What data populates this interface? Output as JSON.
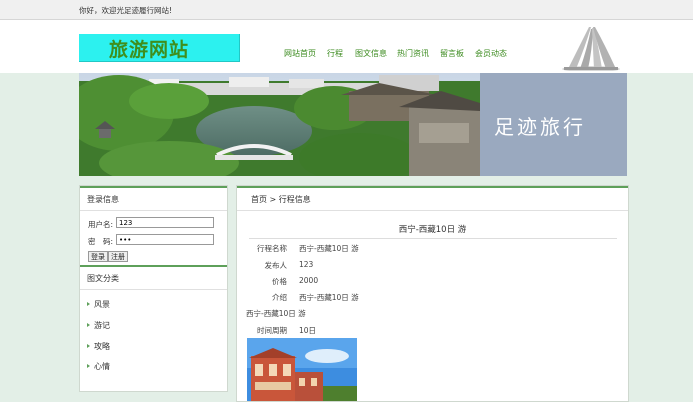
{
  "topbar": {
    "welcome": "你好，欢迎光足迹履行网站!"
  },
  "header": {
    "logo_text": "旅游网站",
    "nav": [
      "网站首页",
      "行程",
      "图文信息",
      "热门资讯",
      "留言板",
      "会员动态"
    ]
  },
  "banner": {
    "slogan": "足迹旅行"
  },
  "login": {
    "title": "登录信息",
    "username_label": "用户名:",
    "username_value": "123",
    "password_label": "密　码:",
    "password_value": "•••",
    "login_button": "登录",
    "register_button": "注册"
  },
  "categories": {
    "title": "图文分类",
    "items": [
      "风景",
      "游记",
      "攻略",
      "心情"
    ]
  },
  "breadcrumb": "首页 > 行程信息",
  "article": {
    "title": "西宁-西藏10日 游",
    "fields": [
      {
        "label": "行程名称",
        "value": "西宁-西藏10日 游"
      },
      {
        "label": "发布人",
        "value": "123"
      },
      {
        "label": "价格",
        "value": "2000"
      },
      {
        "label": "介绍",
        "value": "西宁-西藏10日 游"
      }
    ],
    "intro_text": "西宁-西藏10日 游",
    "period_label": "时间周期",
    "period_value": "10日"
  },
  "colors": {
    "accent_green": "#3a8a1d",
    "logo_bg": "#2cf1ef",
    "banner_panel": "#9aa9bf"
  }
}
